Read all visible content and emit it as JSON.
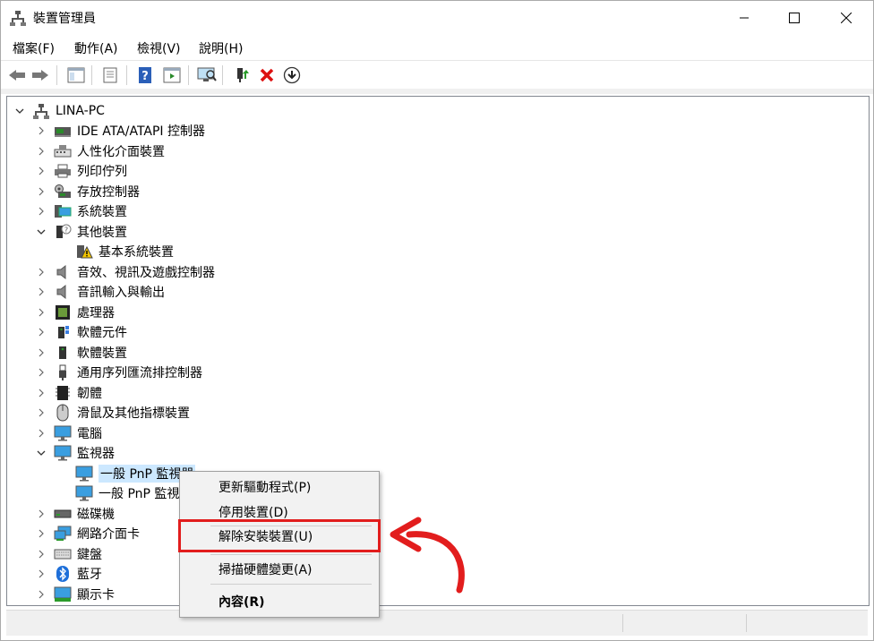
{
  "window": {
    "title": "裝置管理員"
  },
  "menu": [
    "檔案(F)",
    "動作(A)",
    "檢視(V)",
    "說明(H)"
  ],
  "toolbar_icons": [
    "back-arrow-icon",
    "forward-arrow-icon",
    "show-hide-tree-icon",
    "properties-icon",
    "help-icon",
    "run-icon",
    "scan-hardware-icon",
    "update-driver-icon",
    "uninstall-icon",
    "download-icon"
  ],
  "tree": {
    "root": "LINA-PC",
    "nodes": [
      {
        "label": "IDE ATA/ATAPI 控制器",
        "icon": "ide-controller-icon",
        "expanded": false
      },
      {
        "label": "人性化介面裝置",
        "icon": "hid-icon",
        "expanded": false
      },
      {
        "label": "列印佇列",
        "icon": "printer-icon",
        "expanded": false
      },
      {
        "label": "存放控制器",
        "icon": "storage-controller-icon",
        "expanded": false
      },
      {
        "label": "系統裝置",
        "icon": "system-device-icon",
        "expanded": false
      },
      {
        "label": "其他裝置",
        "icon": "other-device-icon",
        "expanded": true,
        "children": [
          {
            "label": "基本系統裝置",
            "icon": "warning-device-icon"
          }
        ]
      },
      {
        "label": "音效、視訊及遊戲控制器",
        "icon": "speaker-icon",
        "expanded": false
      },
      {
        "label": "音訊輸入與輸出",
        "icon": "speaker-icon",
        "expanded": false
      },
      {
        "label": "處理器",
        "icon": "cpu-icon",
        "expanded": false
      },
      {
        "label": "軟體元件",
        "icon": "software-component-icon",
        "expanded": false
      },
      {
        "label": "軟體裝置",
        "icon": "software-device-icon",
        "expanded": false
      },
      {
        "label": "通用序列匯流排控制器",
        "icon": "usb-icon",
        "expanded": false
      },
      {
        "label": "韌體",
        "icon": "firmware-icon",
        "expanded": false
      },
      {
        "label": "滑鼠及其他指標裝置",
        "icon": "mouse-icon",
        "expanded": false
      },
      {
        "label": "電腦",
        "icon": "computer-icon",
        "expanded": false
      },
      {
        "label": "監視器",
        "icon": "monitor-icon",
        "expanded": true,
        "children": [
          {
            "label": "一般 PnP 監視器",
            "icon": "monitor-icon",
            "selected": true
          },
          {
            "label": "一般 PnP 監視器",
            "icon": "monitor-icon"
          }
        ]
      },
      {
        "label": "磁碟機",
        "icon": "disk-drive-icon",
        "expanded": false
      },
      {
        "label": "網路介面卡",
        "icon": "network-adapter-icon",
        "expanded": false
      },
      {
        "label": "鍵盤",
        "icon": "keyboard-icon",
        "expanded": false
      },
      {
        "label": "藍牙",
        "icon": "bluetooth-icon",
        "expanded": false
      },
      {
        "label": "顯示卡",
        "icon": "display-adapter-icon",
        "expanded": false
      }
    ]
  },
  "context_menu": {
    "items": [
      {
        "label": "更新驅動程式(P)"
      },
      {
        "label": "停用裝置(D)"
      },
      {
        "label": "解除安裝裝置(U)",
        "highlighted": true
      },
      {
        "label": "掃描硬體變更(A)"
      },
      {
        "label": "內容(R)",
        "bold": true
      }
    ]
  },
  "colors": {
    "selection": "#cce8ff",
    "highlight_box": "#e21d1d",
    "arrow": "#e21d1d"
  }
}
